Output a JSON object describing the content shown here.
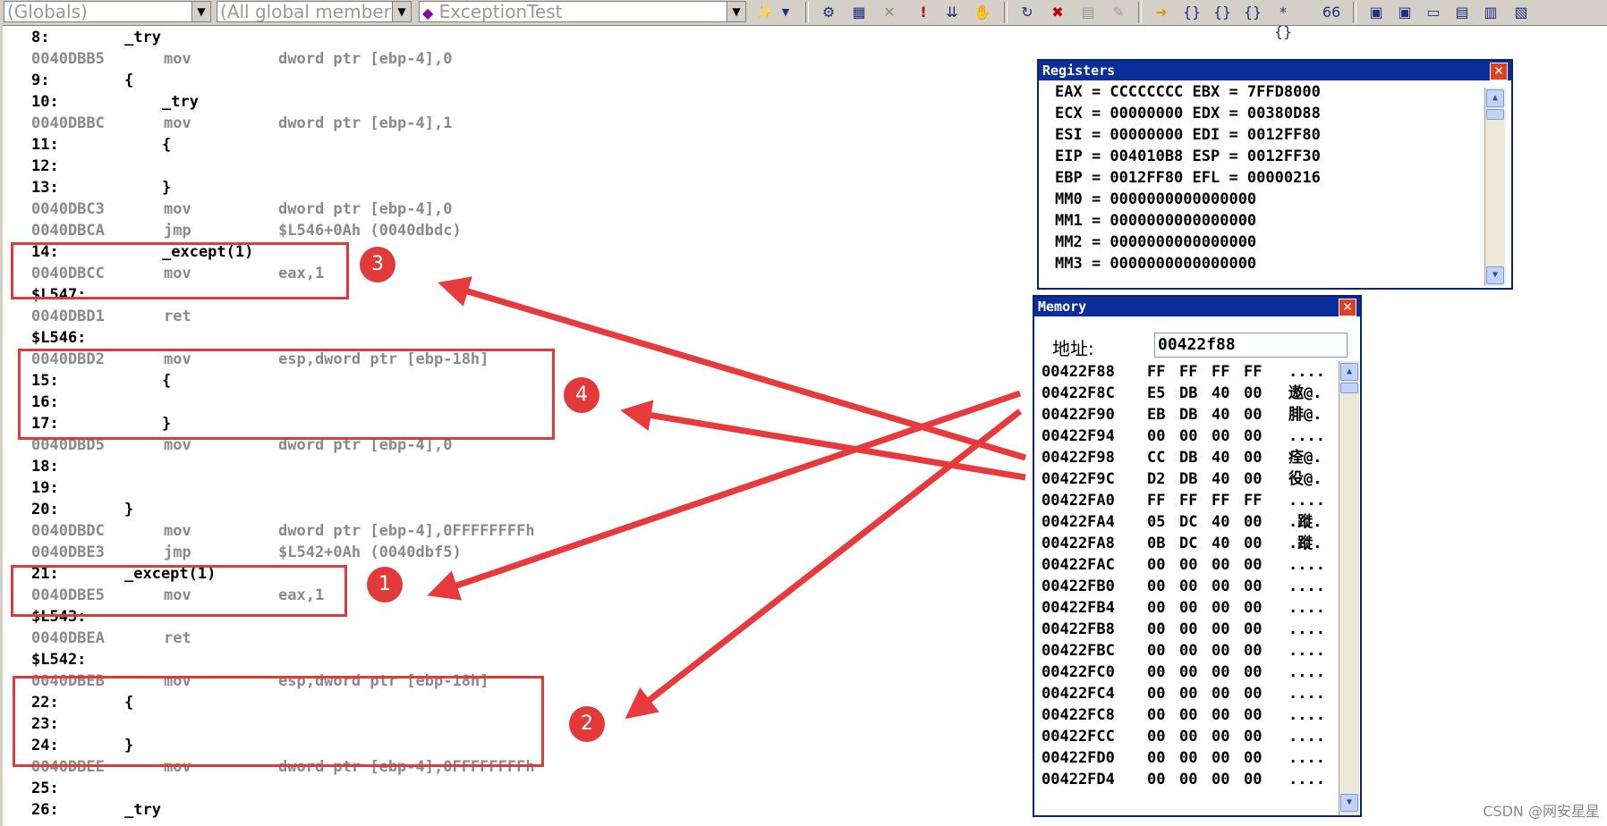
{
  "toolbar": {
    "combo_scope": "(Globals)",
    "combo_members": "(All global members",
    "combo_function": "ExceptionTest"
  },
  "code_lines": [
    {
      "kind": "src",
      "num": "8:",
      "text": "_try",
      "indent": 0
    },
    {
      "kind": "asm",
      "addr": "0040DBB5",
      "op": "mov",
      "arg": "dword ptr [ebp-4],0"
    },
    {
      "kind": "src",
      "num": "9:",
      "text": "{",
      "indent": 0
    },
    {
      "kind": "src",
      "num": "10:",
      "text": "_try",
      "indent": 1
    },
    {
      "kind": "asm",
      "addr": "0040DBBC",
      "op": "mov",
      "arg": "dword ptr [ebp-4],1"
    },
    {
      "kind": "src",
      "num": "11:",
      "text": "{",
      "indent": 1
    },
    {
      "kind": "src",
      "num": "12:",
      "text": "",
      "indent": 0
    },
    {
      "kind": "src",
      "num": "13:",
      "text": "}",
      "indent": 1
    },
    {
      "kind": "asm",
      "addr": "0040DBC3",
      "op": "mov",
      "arg": "dword ptr [ebp-4],0"
    },
    {
      "kind": "asm",
      "addr": "0040DBCA",
      "op": "jmp",
      "arg": "$L546+0Ah (0040dbdc)"
    },
    {
      "kind": "src",
      "num": "14:",
      "text": "_except(1)",
      "indent": 1
    },
    {
      "kind": "asm",
      "addr": "0040DBCC",
      "op": "mov",
      "arg": "eax,1"
    },
    {
      "kind": "label",
      "text": "$L547:"
    },
    {
      "kind": "asm",
      "addr": "0040DBD1",
      "op": "ret",
      "arg": ""
    },
    {
      "kind": "label",
      "text": "$L546:"
    },
    {
      "kind": "asm",
      "addr": "0040DBD2",
      "op": "mov",
      "arg": "esp,dword ptr [ebp-18h]"
    },
    {
      "kind": "src",
      "num": "15:",
      "text": "{",
      "indent": 1
    },
    {
      "kind": "src",
      "num": "16:",
      "text": "",
      "indent": 0
    },
    {
      "kind": "src",
      "num": "17:",
      "text": "}",
      "indent": 1
    },
    {
      "kind": "asm",
      "addr": "0040DBD5",
      "op": "mov",
      "arg": "dword ptr [ebp-4],0"
    },
    {
      "kind": "src",
      "num": "18:",
      "text": "",
      "indent": 0
    },
    {
      "kind": "src",
      "num": "19:",
      "text": "",
      "indent": 0
    },
    {
      "kind": "src",
      "num": "20:",
      "text": "}",
      "indent": 0
    },
    {
      "kind": "asm",
      "addr": "0040DBDC",
      "op": "mov",
      "arg": "dword ptr [ebp-4],0FFFFFFFFh"
    },
    {
      "kind": "asm",
      "addr": "0040DBE3",
      "op": "jmp",
      "arg": "$L542+0Ah (0040dbf5)"
    },
    {
      "kind": "src",
      "num": "21:",
      "text": "_except(1)",
      "indent": 0
    },
    {
      "kind": "asm",
      "addr": "0040DBE5",
      "op": "mov",
      "arg": "eax,1"
    },
    {
      "kind": "label",
      "text": "$L543:"
    },
    {
      "kind": "asm",
      "addr": "0040DBEA",
      "op": "ret",
      "arg": ""
    },
    {
      "kind": "label",
      "text": "$L542:"
    },
    {
      "kind": "asm",
      "addr": "0040DBEB",
      "op": "mov",
      "arg": "esp,dword ptr [ebp-18h]"
    },
    {
      "kind": "src",
      "num": "22:",
      "text": "{",
      "indent": 0
    },
    {
      "kind": "src",
      "num": "23:",
      "text": "",
      "indent": 0
    },
    {
      "kind": "src",
      "num": "24:",
      "text": "}",
      "indent": 0
    },
    {
      "kind": "asm",
      "addr": "0040DBEE",
      "op": "mov",
      "arg": "dword ptr [ebp-4],0FFFFFFFFh"
    },
    {
      "kind": "src",
      "num": "25:",
      "text": "",
      "indent": 0
    },
    {
      "kind": "src",
      "num": "26:",
      "text": "_try",
      "indent": 0
    }
  ],
  "annotations": {
    "badges": [
      "1",
      "2",
      "3",
      "4"
    ],
    "color": "#e23a3a"
  },
  "registers": {
    "title": "Registers",
    "lines": [
      "EAX = CCCCCCCC EBX = 7FFD8000",
      "ECX = 00000000 EDX = 00380D88",
      "ESI = 00000000 EDI = 0012FF80",
      "EIP = 004010B8 ESP = 0012FF30",
      "EBP = 0012FF80 EFL = 00000216",
      "MM0 = 0000000000000000",
      "MM1 = 0000000000000000",
      "MM2 = 0000000000000000",
      "MM3 = 0000000000000000"
    ]
  },
  "memory": {
    "title": "Memory",
    "address_label": "地址:",
    "address_value": "00422f88",
    "rows": [
      {
        "addr": "00422F88",
        "bytes": [
          "FF",
          "FF",
          "FF",
          "FF"
        ],
        "ascii": "...."
      },
      {
        "addr": "00422F8C",
        "bytes": [
          "E5",
          "DB",
          "40",
          "00"
        ],
        "ascii": "遨@."
      },
      {
        "addr": "00422F90",
        "bytes": [
          "EB",
          "DB",
          "40",
          "00"
        ],
        "ascii": "腓@."
      },
      {
        "addr": "00422F94",
        "bytes": [
          "00",
          "00",
          "00",
          "00"
        ],
        "ascii": "...."
      },
      {
        "addr": "00422F98",
        "bytes": [
          "CC",
          "DB",
          "40",
          "00"
        ],
        "ascii": "痊@."
      },
      {
        "addr": "00422F9C",
        "bytes": [
          "D2",
          "DB",
          "40",
          "00"
        ],
        "ascii": "役@."
      },
      {
        "addr": "00422FA0",
        "bytes": [
          "FF",
          "FF",
          "FF",
          "FF"
        ],
        "ascii": "...."
      },
      {
        "addr": "00422FA4",
        "bytes": [
          "05",
          "DC",
          "40",
          "00"
        ],
        "ascii": ".蹝."
      },
      {
        "addr": "00422FA8",
        "bytes": [
          "0B",
          "DC",
          "40",
          "00"
        ],
        "ascii": ".蹝."
      },
      {
        "addr": "00422FAC",
        "bytes": [
          "00",
          "00",
          "00",
          "00"
        ],
        "ascii": "...."
      },
      {
        "addr": "00422FB0",
        "bytes": [
          "00",
          "00",
          "00",
          "00"
        ],
        "ascii": "...."
      },
      {
        "addr": "00422FB4",
        "bytes": [
          "00",
          "00",
          "00",
          "00"
        ],
        "ascii": "...."
      },
      {
        "addr": "00422FB8",
        "bytes": [
          "00",
          "00",
          "00",
          "00"
        ],
        "ascii": "...."
      },
      {
        "addr": "00422FBC",
        "bytes": [
          "00",
          "00",
          "00",
          "00"
        ],
        "ascii": "...."
      },
      {
        "addr": "00422FC0",
        "bytes": [
          "00",
          "00",
          "00",
          "00"
        ],
        "ascii": "...."
      },
      {
        "addr": "00422FC4",
        "bytes": [
          "00",
          "00",
          "00",
          "00"
        ],
        "ascii": "...."
      },
      {
        "addr": "00422FC8",
        "bytes": [
          "00",
          "00",
          "00",
          "00"
        ],
        "ascii": "...."
      },
      {
        "addr": "00422FCC",
        "bytes": [
          "00",
          "00",
          "00",
          "00"
        ],
        "ascii": "...."
      },
      {
        "addr": "00422FD0",
        "bytes": [
          "00",
          "00",
          "00",
          "00"
        ],
        "ascii": "...."
      },
      {
        "addr": "00422FD4",
        "bytes": [
          "00",
          "00",
          "00",
          "00"
        ],
        "ascii": "...."
      }
    ]
  },
  "watermark": "CSDN @网安星星"
}
